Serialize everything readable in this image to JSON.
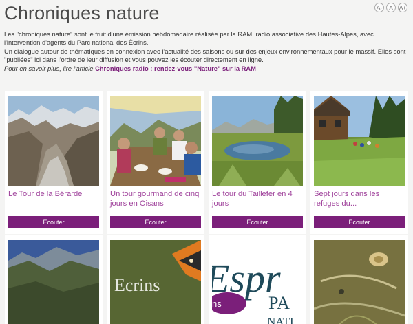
{
  "page": {
    "title": "Chroniques nature",
    "text_size_controls": [
      "A-",
      "A",
      "A+"
    ]
  },
  "intro": {
    "p1": "Les \"chroniques nature\" sont le fruit d'une émission hebdomadaire réalisée par la RAM, radio associative des Hautes-Alpes, avec l'intervention d'agents du Parc national des Écrins.",
    "p2": "Un dialogue autour de thématiques en connexion avec l'actualité des saisons ou sur des enjeux environnementaux pour le massif. Elles sont \"publiées\" ici dans l'ordre de leur diffusion et vous pouvez les écouter directement en ligne.",
    "more_prefix": "Pour en savoir plus, lire l'article ",
    "more_link": "Chroniques radio : rendez-vous \"Nature\" sur la RAM"
  },
  "cards": [
    {
      "title": "Le Tour de la Bérarde",
      "button": "Ecouter"
    },
    {
      "title": "Un tour gourmand de cinq jours en Oisans",
      "button": "Ecouter"
    },
    {
      "title": "Le tour du Taillefer en 4 jours",
      "button": "Ecouter"
    },
    {
      "title": "Sept jours dans les refuges du...",
      "button": "Ecouter"
    },
    {
      "title": "",
      "button": ""
    },
    {
      "title": "",
      "button": ""
    },
    {
      "title": "",
      "button": ""
    },
    {
      "title": "",
      "button": ""
    }
  ],
  "image_text": {
    "ecrins": "Ecrins",
    "espr": "Espr",
    "pa": "PA",
    "nati": "NATI",
    "ns": "ns"
  }
}
